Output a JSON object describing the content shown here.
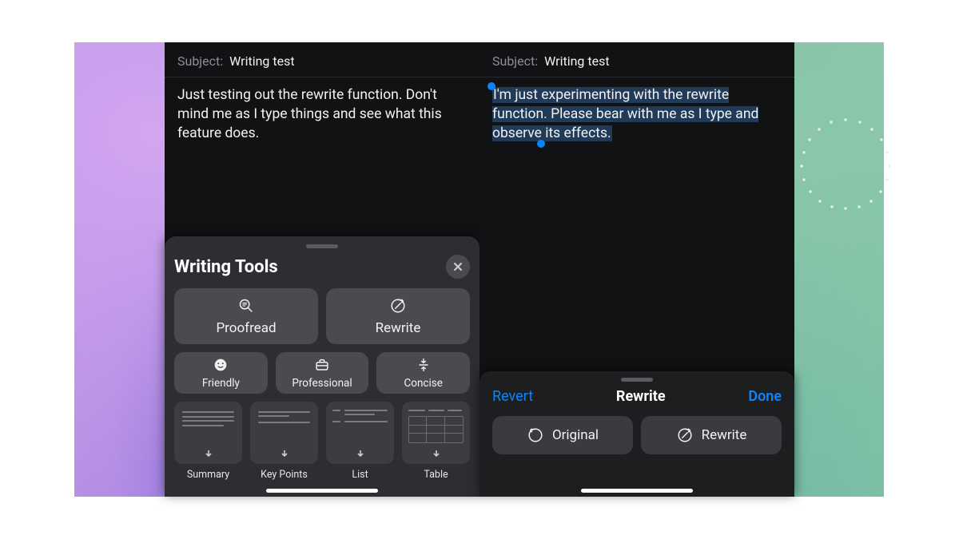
{
  "left": {
    "subject_label": "Subject:",
    "subject_value": "Writing test",
    "body": "Just testing out the rewrite function. Don't mind me as I type things and see what this feature does.",
    "sheet": {
      "title": "Writing Tools",
      "close_icon": "close",
      "primary": [
        {
          "label": "Proofread",
          "icon": "magnify-text"
        },
        {
          "label": "Rewrite",
          "icon": "rewrite-circle"
        }
      ],
      "tone": [
        {
          "label": "Friendly",
          "icon": "smile"
        },
        {
          "label": "Professional",
          "icon": "briefcase"
        },
        {
          "label": "Concise",
          "icon": "compress"
        }
      ],
      "formats": [
        {
          "label": "Summary",
          "icon": "summary"
        },
        {
          "label": "Key Points",
          "icon": "keypoints"
        },
        {
          "label": "List",
          "icon": "list"
        },
        {
          "label": "Table",
          "icon": "table"
        }
      ]
    }
  },
  "right": {
    "subject_label": "Subject:",
    "subject_value": "Writing test",
    "body_selected": "I'm just experimenting with the rewrite function. Please bear with me as I type and observe its effects.",
    "sheet": {
      "revert": "Revert",
      "title": "Rewrite",
      "done": "Done",
      "buttons": [
        {
          "label": "Original",
          "icon": "revert-circle"
        },
        {
          "label": "Rewrite",
          "icon": "rewrite-circle"
        }
      ]
    }
  }
}
